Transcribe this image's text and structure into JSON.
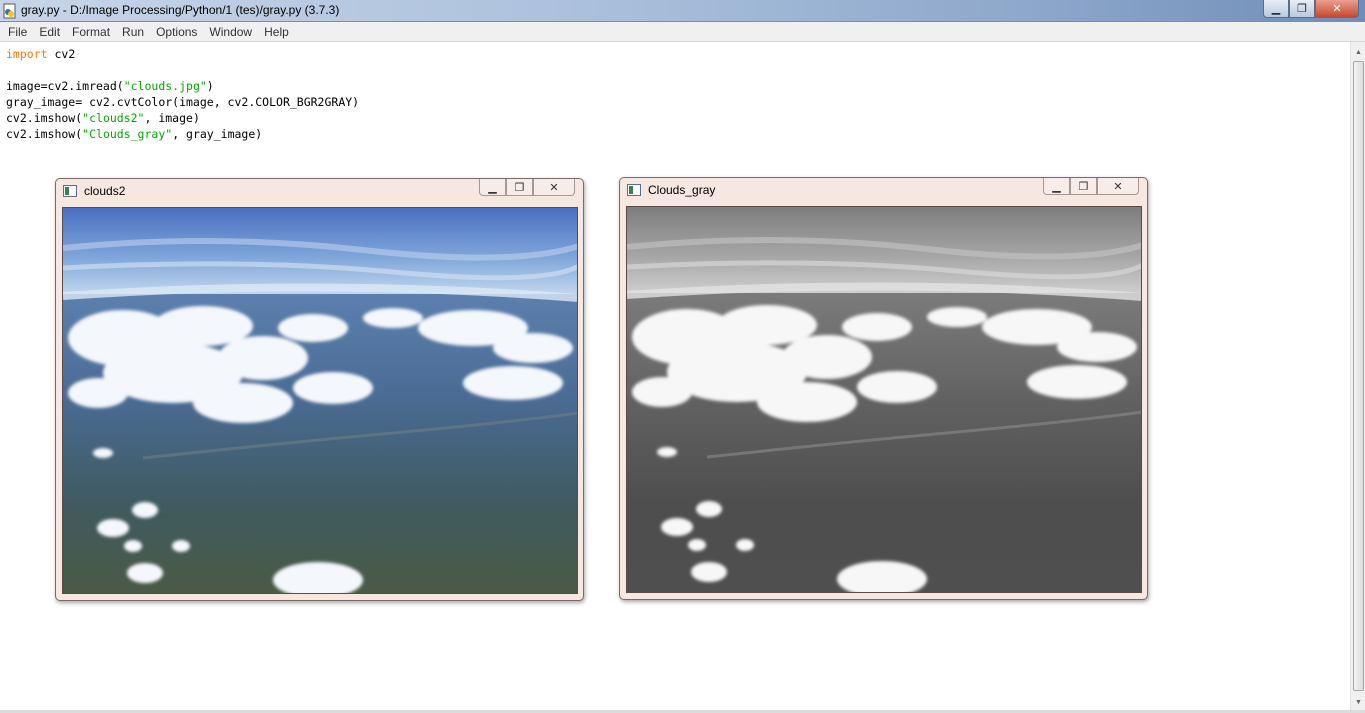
{
  "window": {
    "title": "gray.py - D:/Image Processing/Python/1 (tes)/gray.py (3.7.3)",
    "icon": "python-file-icon",
    "buttons": {
      "minimize": "▁",
      "maximize": "❐",
      "close": "✕"
    }
  },
  "menu": [
    "File",
    "Edit",
    "Format",
    "Run",
    "Options",
    "Window",
    "Help"
  ],
  "code": {
    "line1_kw": "import",
    "line1_rest": " cv2",
    "line3_pre": "image=cv2.imread(",
    "line3_str": "\"clouds.jpg\"",
    "line3_post": ")",
    "line4": "gray_image= cv2.cvtColor(image, cv2.COLOR_BGR2GRAY)",
    "line5_pre": "cv2.imshow(",
    "line5_str": "\"clouds2\"",
    "line5_post": ", image)",
    "line6_pre": "cv2.imshow(",
    "line6_str": "\"Clouds_gray\"",
    "line6_post": ", gray_image)"
  },
  "cv_windows": [
    {
      "title": "clouds2",
      "kind": "color-aerial-clouds-photo"
    },
    {
      "title": "Clouds_gray",
      "kind": "grayscale-aerial-clouds-photo"
    }
  ],
  "colors": {
    "keyword": "#ff7700",
    "string": "#00aa00",
    "cv_frame": "#f6e7e1"
  }
}
